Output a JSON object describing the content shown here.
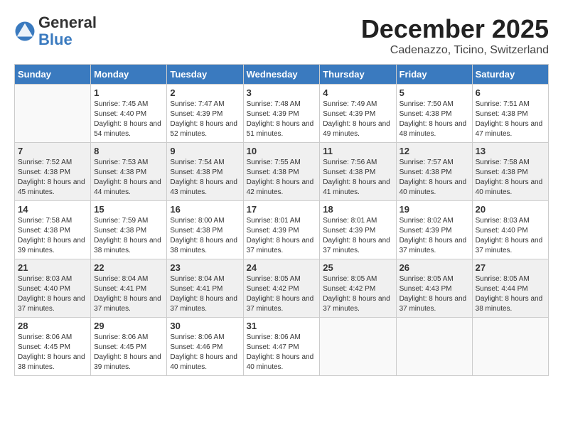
{
  "header": {
    "logo_general": "General",
    "logo_blue": "Blue",
    "month_title": "December 2025",
    "location": "Cadenazzo, Ticino, Switzerland"
  },
  "weekdays": [
    "Sunday",
    "Monday",
    "Tuesday",
    "Wednesday",
    "Thursday",
    "Friday",
    "Saturday"
  ],
  "weeks": [
    [
      {
        "day": null
      },
      {
        "day": 1,
        "sunrise": "7:45 AM",
        "sunset": "4:40 PM",
        "daylight": "8 hours and 54 minutes."
      },
      {
        "day": 2,
        "sunrise": "7:47 AM",
        "sunset": "4:39 PM",
        "daylight": "8 hours and 52 minutes."
      },
      {
        "day": 3,
        "sunrise": "7:48 AM",
        "sunset": "4:39 PM",
        "daylight": "8 hours and 51 minutes."
      },
      {
        "day": 4,
        "sunrise": "7:49 AM",
        "sunset": "4:39 PM",
        "daylight": "8 hours and 49 minutes."
      },
      {
        "day": 5,
        "sunrise": "7:50 AM",
        "sunset": "4:38 PM",
        "daylight": "8 hours and 48 minutes."
      },
      {
        "day": 6,
        "sunrise": "7:51 AM",
        "sunset": "4:38 PM",
        "daylight": "8 hours and 47 minutes."
      }
    ],
    [
      {
        "day": 7,
        "sunrise": "7:52 AM",
        "sunset": "4:38 PM",
        "daylight": "8 hours and 45 minutes."
      },
      {
        "day": 8,
        "sunrise": "7:53 AM",
        "sunset": "4:38 PM",
        "daylight": "8 hours and 44 minutes."
      },
      {
        "day": 9,
        "sunrise": "7:54 AM",
        "sunset": "4:38 PM",
        "daylight": "8 hours and 43 minutes."
      },
      {
        "day": 10,
        "sunrise": "7:55 AM",
        "sunset": "4:38 PM",
        "daylight": "8 hours and 42 minutes."
      },
      {
        "day": 11,
        "sunrise": "7:56 AM",
        "sunset": "4:38 PM",
        "daylight": "8 hours and 41 minutes."
      },
      {
        "day": 12,
        "sunrise": "7:57 AM",
        "sunset": "4:38 PM",
        "daylight": "8 hours and 40 minutes."
      },
      {
        "day": 13,
        "sunrise": "7:58 AM",
        "sunset": "4:38 PM",
        "daylight": "8 hours and 40 minutes."
      }
    ],
    [
      {
        "day": 14,
        "sunrise": "7:58 AM",
        "sunset": "4:38 PM",
        "daylight": "8 hours and 39 minutes."
      },
      {
        "day": 15,
        "sunrise": "7:59 AM",
        "sunset": "4:38 PM",
        "daylight": "8 hours and 38 minutes."
      },
      {
        "day": 16,
        "sunrise": "8:00 AM",
        "sunset": "4:38 PM",
        "daylight": "8 hours and 38 minutes."
      },
      {
        "day": 17,
        "sunrise": "8:01 AM",
        "sunset": "4:39 PM",
        "daylight": "8 hours and 37 minutes."
      },
      {
        "day": 18,
        "sunrise": "8:01 AM",
        "sunset": "4:39 PM",
        "daylight": "8 hours and 37 minutes."
      },
      {
        "day": 19,
        "sunrise": "8:02 AM",
        "sunset": "4:39 PM",
        "daylight": "8 hours and 37 minutes."
      },
      {
        "day": 20,
        "sunrise": "8:03 AM",
        "sunset": "4:40 PM",
        "daylight": "8 hours and 37 minutes."
      }
    ],
    [
      {
        "day": 21,
        "sunrise": "8:03 AM",
        "sunset": "4:40 PM",
        "daylight": "8 hours and 37 minutes."
      },
      {
        "day": 22,
        "sunrise": "8:04 AM",
        "sunset": "4:41 PM",
        "daylight": "8 hours and 37 minutes."
      },
      {
        "day": 23,
        "sunrise": "8:04 AM",
        "sunset": "4:41 PM",
        "daylight": "8 hours and 37 minutes."
      },
      {
        "day": 24,
        "sunrise": "8:05 AM",
        "sunset": "4:42 PM",
        "daylight": "8 hours and 37 minutes."
      },
      {
        "day": 25,
        "sunrise": "8:05 AM",
        "sunset": "4:42 PM",
        "daylight": "8 hours and 37 minutes."
      },
      {
        "day": 26,
        "sunrise": "8:05 AM",
        "sunset": "4:43 PM",
        "daylight": "8 hours and 37 minutes."
      },
      {
        "day": 27,
        "sunrise": "8:05 AM",
        "sunset": "4:44 PM",
        "daylight": "8 hours and 38 minutes."
      }
    ],
    [
      {
        "day": 28,
        "sunrise": "8:06 AM",
        "sunset": "4:45 PM",
        "daylight": "8 hours and 38 minutes."
      },
      {
        "day": 29,
        "sunrise": "8:06 AM",
        "sunset": "4:45 PM",
        "daylight": "8 hours and 39 minutes."
      },
      {
        "day": 30,
        "sunrise": "8:06 AM",
        "sunset": "4:46 PM",
        "daylight": "8 hours and 40 minutes."
      },
      {
        "day": 31,
        "sunrise": "8:06 AM",
        "sunset": "4:47 PM",
        "daylight": "8 hours and 40 minutes."
      },
      {
        "day": null
      },
      {
        "day": null
      },
      {
        "day": null
      }
    ]
  ]
}
